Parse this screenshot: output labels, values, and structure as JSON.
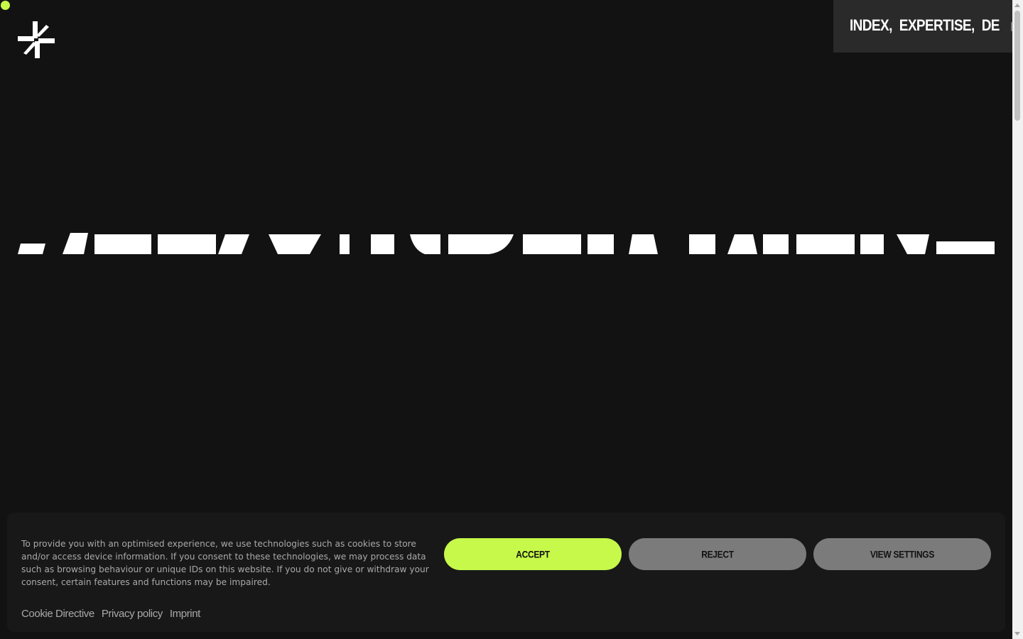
{
  "colors": {
    "background": "#121212",
    "accent": "#c6f94a",
    "nav_background": "#2a2a2a",
    "secondary_button": "#7b7b7b"
  },
  "logo": {
    "icon": "asterisk-logo-icon"
  },
  "nav": {
    "links": [
      {
        "label": "INDEX,"
      },
      {
        "label": "EXPERTISE,"
      },
      {
        "label": "DE"
      }
    ],
    "theme_toggle": {
      "icon": "toggle-switch-icon"
    }
  },
  "cookie_banner": {
    "text": "To provide you with an optimised experience, we use technologies such as cookies to store and/or access device information. If you consent to these technologies, we may process data such as browsing behaviour or unique IDs on this website. If you do not give or withdraw your consent, certain features and functions may be impaired.",
    "links": [
      {
        "label": "Cookie Directive"
      },
      {
        "label": "Privacy policy"
      },
      {
        "label": "Imprint"
      }
    ],
    "buttons": {
      "accept": "ACCEPT",
      "reject": "REJECT",
      "settings": "VIEW SETTINGS"
    }
  }
}
